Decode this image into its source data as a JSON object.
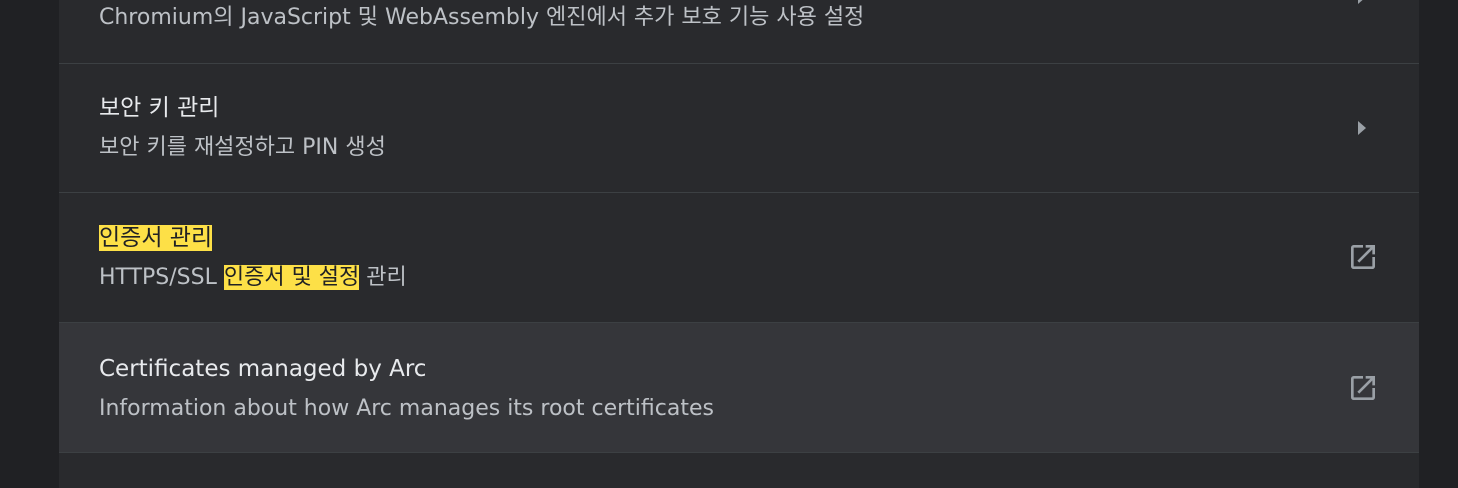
{
  "rows": [
    {
      "subtitle": "Chromium의 JavaScript 및 WebAssembly 엔진에서 추가 보호 기능 사용 설정",
      "action_icon": "chevron-right-icon"
    },
    {
      "title": "보안 키 관리",
      "subtitle": "보안 키를 재설정하고 PIN 생성",
      "action_icon": "chevron-right-icon"
    },
    {
      "title": "인증서 관리",
      "subtitle_before": "HTTPS/SSL ",
      "subtitle_highlight": "인증서 및 설정",
      "subtitle_after": " 관리",
      "action_icon": "open-in-new-icon",
      "highlight_color": "#fde047"
    },
    {
      "title": "Certificates managed by Arc",
      "subtitle": "Information about how Arc manages its root certificates",
      "action_icon": "open-in-new-icon"
    }
  ]
}
